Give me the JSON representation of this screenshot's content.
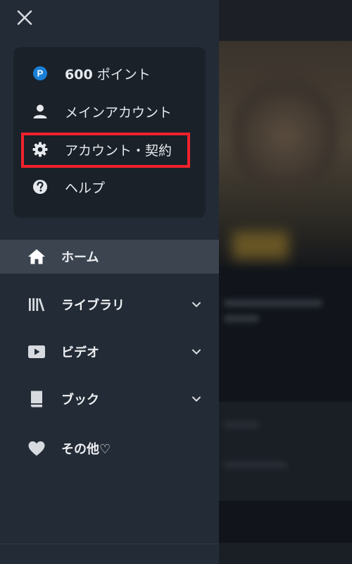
{
  "drawer": {
    "close_icon": "close-icon",
    "account_menu": [
      {
        "icon": "points-badge-icon",
        "badge": "P",
        "value": "600",
        "unit": " ポイント"
      },
      {
        "icon": "person-icon",
        "label": "メインアカウント"
      },
      {
        "icon": "gear-icon",
        "label": "アカウント・契約"
      },
      {
        "icon": "help-icon",
        "label": "ヘルプ"
      }
    ],
    "nav": [
      {
        "icon": "home-icon",
        "label": "ホーム",
        "active": true
      },
      {
        "icon": "library-icon",
        "label": "ライブラリ",
        "expandable": true
      },
      {
        "icon": "video-icon",
        "label": "ビデオ",
        "expandable": true
      },
      {
        "icon": "book-icon",
        "label": "ブック",
        "expandable": true
      },
      {
        "icon": "heart-icon",
        "label": "その他♡"
      }
    ]
  },
  "colors": {
    "drawer_bg": "#232b36",
    "card_bg": "#1a2129",
    "active_bg": "#3c4450",
    "highlight": "#f0222c",
    "points_badge": "#1a7fd6"
  }
}
